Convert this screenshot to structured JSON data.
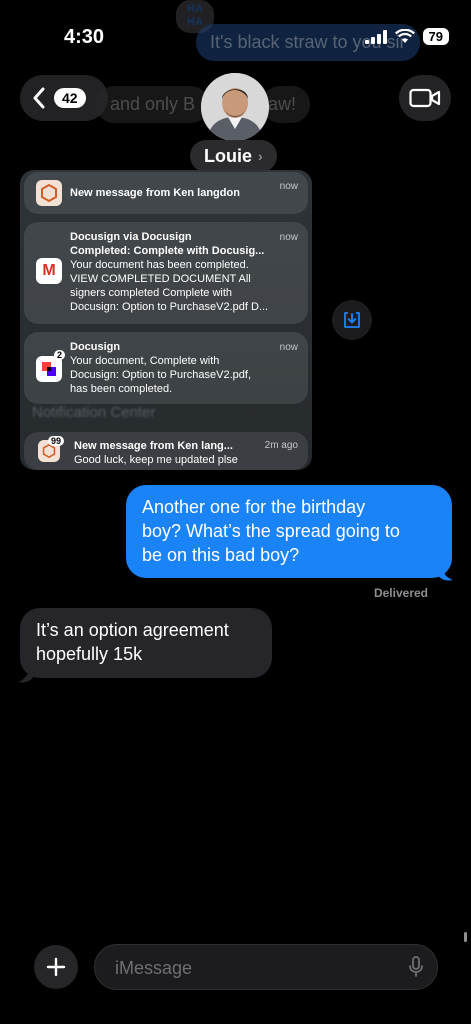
{
  "status_bar": {
    "time": "4:30",
    "battery": "79"
  },
  "background_messages": {
    "haha_line1": "HA",
    "haha_line2": "HA",
    "top_bubble": "It's black straw to you sir",
    "second_bubble_left": "and only B",
    "second_bubble_right": "aw!"
  },
  "header": {
    "unread_count": "42",
    "contact_name": "Louie",
    "name_chevron": "›"
  },
  "notifications": {
    "n1": {
      "title": "New message from Ken langdon",
      "time": "now"
    },
    "n2": {
      "title": "Docusign via Docusign",
      "subtitle": "Completed: Complete with Docusig...",
      "body": "Your document has been completed.",
      "body2": "VIEW COMPLETED DOCUMENT All",
      "body3": "signers completed Complete with",
      "body4": "Docusign: Option to PurchaseV2.pdf D...",
      "time": "now",
      "icon_letter": "M"
    },
    "n3": {
      "title": "Docusign",
      "body": "Your document, Complete with",
      "body2": "Docusign: Option to PurchaseV2.pdf,",
      "body3": "has been completed.",
      "time": "now",
      "badge": "2"
    },
    "center_label": "Notification Center",
    "n4": {
      "title": "New message from Ken lang...",
      "body": "Good luck, keep me updated plse",
      "time": "2m ago",
      "badge": "99"
    }
  },
  "conversation": {
    "outgoing": [
      "Another one for the birthday",
      "boy? What’s the spread going to",
      "be on this bad boy?"
    ],
    "status": "Delivered",
    "incoming": [
      "It’s an option agreement",
      "hopefully 15k"
    ]
  },
  "composer": {
    "placeholder": "iMessage"
  },
  "colors": {
    "outgoing_bubble": "#1a83f7",
    "incoming_bubble": "#26252a",
    "background": "#000000"
  },
  "icons": [
    "back-chevron-icon",
    "video-camera-icon",
    "download-icon",
    "plus-icon",
    "microphone-icon",
    "signal-icon",
    "wifi-icon"
  ]
}
